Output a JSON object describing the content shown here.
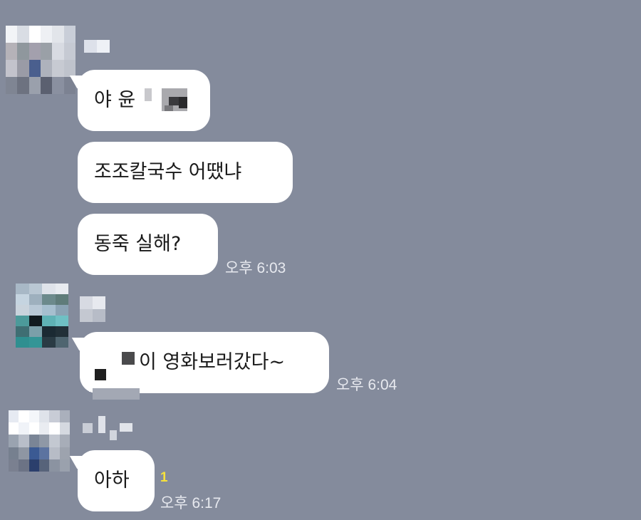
{
  "messages": [
    {
      "sender_avatar_colors": [
        "#f2f4f7",
        "#d9dde4",
        "#ffffff",
        "#eef0f4",
        "#e2e5ea",
        "#c9ced8",
        "#b5b2b8",
        "#8f979d",
        "#a3a0ad",
        "#9aa0a7",
        "#d8dbe2",
        "#c6cad3",
        "#c3c3cc",
        "#9a9ba6",
        "#4a5f8e",
        "#aeb2bc",
        "#c7cad2",
        "#bfc3cc",
        "#7f8593",
        "#6d7280",
        "#9aa0ac",
        "#5b6070",
        "#8a90a0",
        "#7c8292"
      ],
      "bubbles": [
        {
          "text": "야 윤",
          "has_mosaic": true
        },
        {
          "text": "조조칼국수 어땠냐"
        },
        {
          "text": "동죽 실해?"
        }
      ],
      "time": "오후 6:03"
    },
    {
      "sender_avatar_colors": [
        "#a8b8c6",
        "#b9c7d3",
        "#dfe3ea",
        "#e8ebf0",
        "#c5d4e0",
        "#9eb0be",
        "#6c8a8c",
        "#5f7c7a",
        "#c9d3dc",
        "#b8c8d6",
        "#a6bfcf",
        "#8aa3b4",
        "#4c9a9a",
        "#111a1f",
        "#5fb2b5",
        "#6fc0c4",
        "#3f6e73",
        "#7b9fa9",
        "#1b2a33",
        "#223038",
        "#2f8f90",
        "#349596",
        "#2a3b44",
        "#4f6570"
      ],
      "bubbles": [
        {
          "text": "이 영화보러갔다~",
          "has_mosaic_prefix": true
        }
      ],
      "time": "오후 6:04"
    },
    {
      "sender_avatar_colors": [
        "#e6eaf2",
        "#ffffff",
        "#f4f6fa",
        "#dfe3ea",
        "#c8ccd6",
        "#aab0bc",
        "#ffffff",
        "#f0f3f8",
        "#ffffff",
        "#e9ecf1",
        "#ffffff",
        "#d5d9e0",
        "#9aa3b0",
        "#b8bec9",
        "#7a8596",
        "#8f98a6",
        "#c3c8d1",
        "#a7adb8",
        "#76808f",
        "#8e96a3",
        "#3b5a93",
        "#5c73a0",
        "#b7bcc6",
        "#9da3ae",
        "#7a8090",
        "#6c7385",
        "#2b3f6c",
        "#57637a",
        "#8b93a1",
        "#9aa1ad"
      ],
      "bubbles": [
        {
          "text": "아하"
        }
      ],
      "unread_count": "1",
      "time": "오후 6:17"
    }
  ]
}
